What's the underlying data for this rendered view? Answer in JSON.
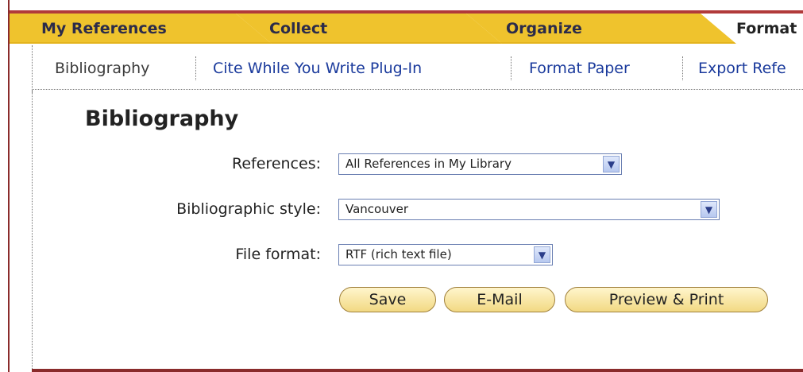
{
  "tabs": [
    {
      "label": "My References"
    },
    {
      "label": "Collect"
    },
    {
      "label": "Organize"
    },
    {
      "label": "Format"
    }
  ],
  "subnav": [
    {
      "label": "Bibliography"
    },
    {
      "label": "Cite While You Write Plug-In"
    },
    {
      "label": "Format Paper"
    },
    {
      "label": "Export Refe"
    }
  ],
  "page": {
    "title": "Bibliography"
  },
  "form": {
    "references_label": "References:",
    "references_value": "All References in My Library",
    "style_label": "Bibliographic style:",
    "style_value": "Vancouver",
    "format_label": "File format:",
    "format_value": "RTF (rich text file)"
  },
  "buttons": {
    "save": "Save",
    "email": "E-Mail",
    "preview": "Preview & Print"
  },
  "icons": {
    "dropdown": "chevron-down-icon"
  },
  "colors": {
    "tab_active_bg": "#ffffff",
    "tab_bg": "#efc32d",
    "link": "#1a3a9c",
    "button_bg": "#f2d983",
    "frame": "#8a2b2b"
  }
}
